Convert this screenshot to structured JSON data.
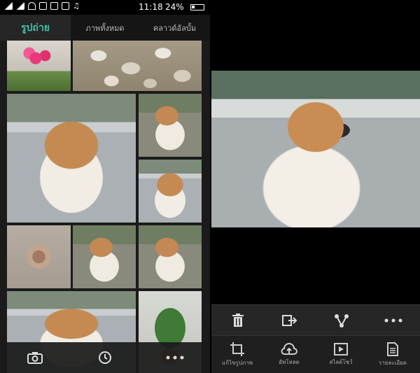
{
  "status_bar": {
    "time": "11:18",
    "battery_percent": "24%"
  },
  "gallery": {
    "tabs": [
      {
        "label": "รูปถ่าย",
        "active": true
      },
      {
        "label": "ภาพทั้งหมด",
        "active": false
      },
      {
        "label": "คลาวด์อัลบั้ม",
        "active": false
      }
    ],
    "bottom_bar": {
      "camera_icon": "camera-icon",
      "timeline_icon": "clock-icon",
      "more_icon": "more-icon"
    }
  },
  "viewer": {
    "toolbar_top": [
      "trash-icon",
      "share-icon",
      "send-icon",
      "more-icon"
    ],
    "toolbar_bottom": [
      {
        "icon": "crop-icon",
        "label": "แก้ไขรูปภาพ"
      },
      {
        "icon": "cloud-upload-icon",
        "label": "อัพโหลด"
      },
      {
        "icon": "play-icon",
        "label": "สไลด์โชว์"
      },
      {
        "icon": "details-icon",
        "label": "รายละเอียด"
      }
    ]
  },
  "colors": {
    "accent": "#3fc4a8",
    "background": "#1b1b1b"
  }
}
